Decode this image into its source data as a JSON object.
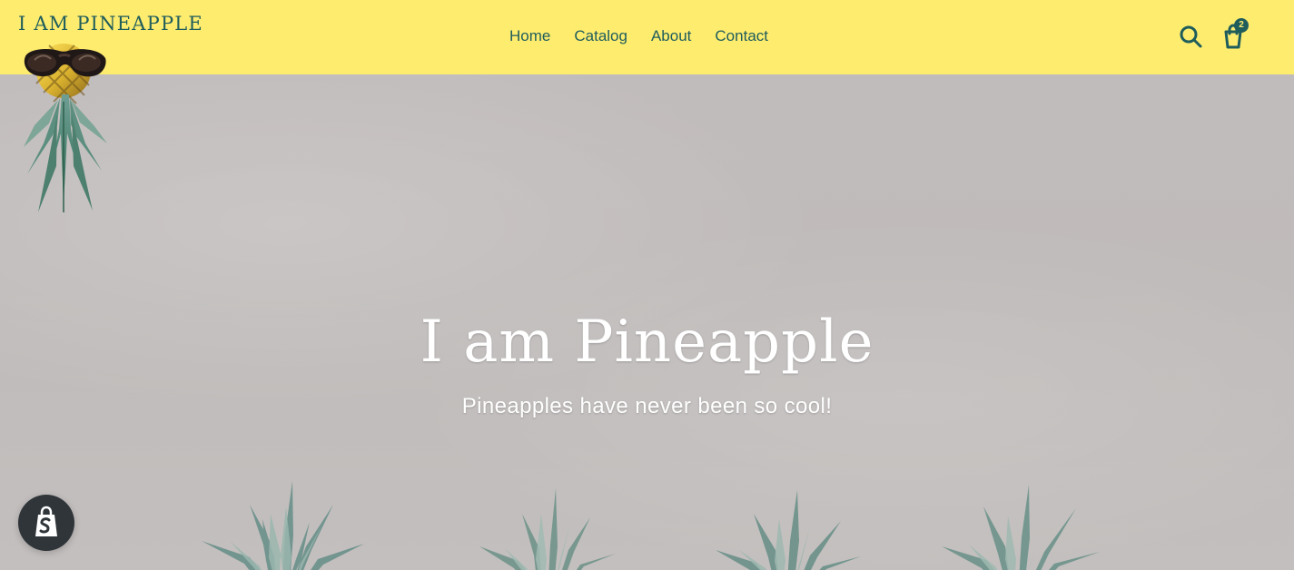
{
  "header": {
    "logo_text": "I AM PINEAPPLE",
    "background": "#feec6f",
    "accent": "#1f5d5c"
  },
  "nav": {
    "items": [
      {
        "label": "Home"
      },
      {
        "label": "Catalog"
      },
      {
        "label": "About"
      },
      {
        "label": "Contact"
      }
    ]
  },
  "actions": {
    "search_icon": "search-icon",
    "cart_icon": "cart-icon",
    "cart_count": "2"
  },
  "hero": {
    "title": "I am Pineapple",
    "subtitle": "Pineapples have never been so cool!",
    "background": "#c1bcbc"
  },
  "floating": {
    "shop_icon": "shopify-bag-icon",
    "background": "#2f3539"
  }
}
